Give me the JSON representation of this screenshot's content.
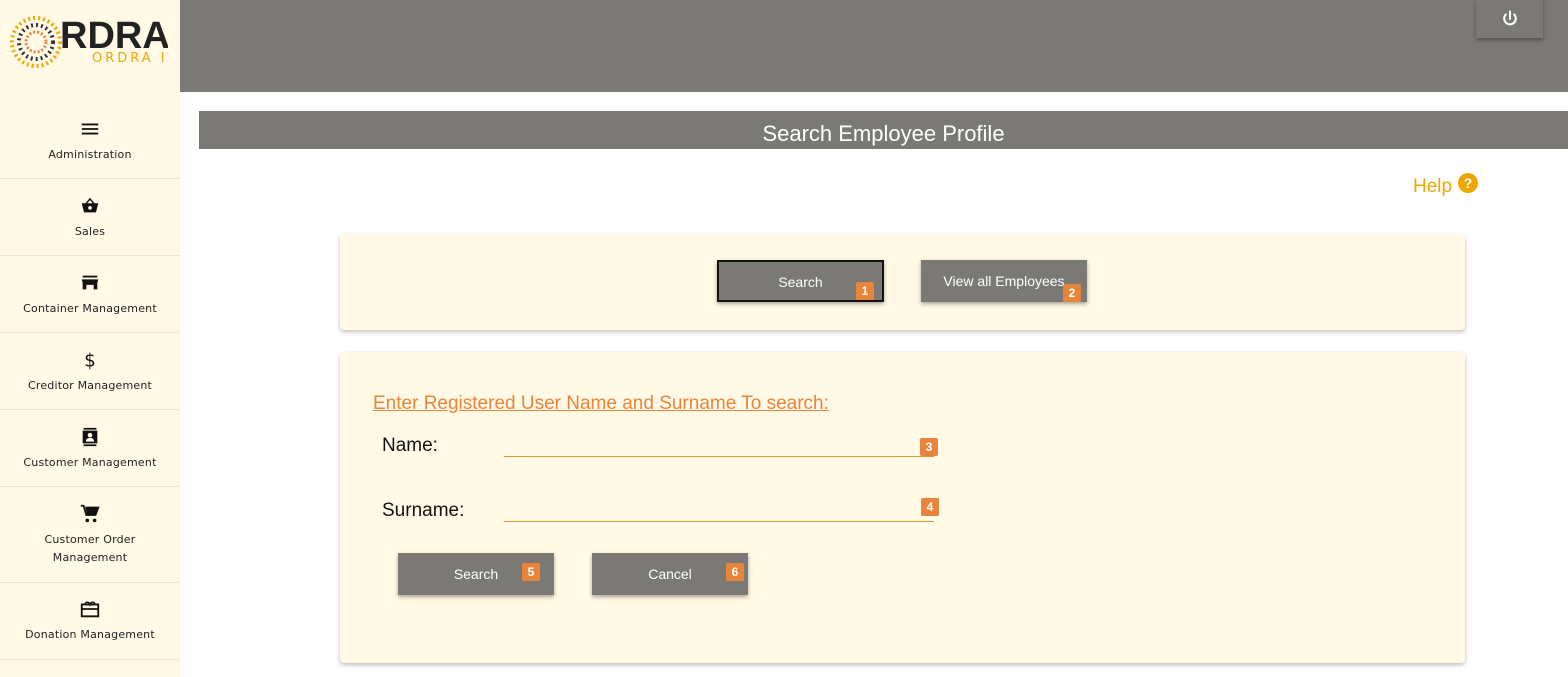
{
  "logo": {
    "main_text": "RDRA",
    "sub_text": "ORDRA IT"
  },
  "sidebar": {
    "items": [
      {
        "label": "Administration",
        "icon": "menu-icon"
      },
      {
        "label": "Sales",
        "icon": "basket-icon"
      },
      {
        "label": "Container Management",
        "icon": "store-icon"
      },
      {
        "label": "Creditor Management",
        "icon": "dollar-icon"
      },
      {
        "label": "Customer Management",
        "icon": "contact-card-icon"
      },
      {
        "label": "Customer Order Management",
        "icon": "cart-icon"
      },
      {
        "label": "Donation Management",
        "icon": "gift-card-icon"
      }
    ]
  },
  "topbar": {
    "power_icon": "power-icon"
  },
  "page": {
    "title": "Search Employee Profile"
  },
  "help": {
    "label": "Help",
    "icon_glyph": "?"
  },
  "actions": {
    "search_label": "Search",
    "search_badge": "1",
    "view_all_label": "View all Employees",
    "view_all_badge": "2"
  },
  "form": {
    "instruction": "Enter Registered User Name and Surname To search:",
    "name_label": "Name:",
    "name_value": "",
    "name_badge": "3",
    "surname_label": "Surname:",
    "surname_value": "",
    "surname_badge": "4",
    "search_label": "Search",
    "search_badge": "5",
    "cancel_label": "Cancel",
    "cancel_badge": "6"
  },
  "colors": {
    "sidebar_bg": "#fff9e6",
    "header_gray": "#7b7975",
    "accent_orange": "#e8853a",
    "help_yellow": "#f0a500"
  }
}
